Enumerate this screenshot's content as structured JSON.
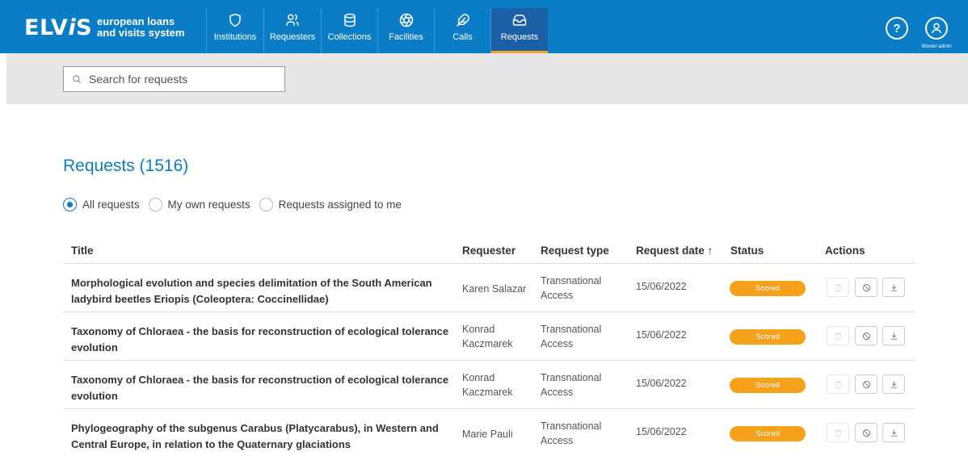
{
  "header": {
    "logo_main": "ELV",
    "logo_i": "i",
    "logo_s": "S",
    "logo_sub_line1": "european loans",
    "logo_sub_line2": "and visits system",
    "nav": [
      {
        "label": "Institutions",
        "icon": "shield-icon"
      },
      {
        "label": "Requesters",
        "icon": "users-icon"
      },
      {
        "label": "Collections",
        "icon": "database-icon"
      },
      {
        "label": "Facilities",
        "icon": "aperture-icon"
      },
      {
        "label": "Calls",
        "icon": "feather-icon"
      },
      {
        "label": "Requests",
        "icon": "inbox-icon",
        "active": true
      }
    ],
    "help_label": "?",
    "user_name": "Wouter admin",
    "brand_color": "#0b7dc7"
  },
  "search": {
    "placeholder": "Search for requests",
    "value": ""
  },
  "page": {
    "title": "Requests (1516)"
  },
  "filters": [
    {
      "label": "All requests",
      "checked": true
    },
    {
      "label": "My own requests",
      "checked": false
    },
    {
      "label": "Requests assigned to me",
      "checked": false
    }
  ],
  "table": {
    "columns": [
      "Title",
      "Requester",
      "Request type",
      "Request date ↑",
      "Status",
      "Actions"
    ],
    "rows": [
      {
        "title": "Morphological evolution and species delimitation of the South American ladybird beetles Eriopis (Coleoptera: Coccinellidae)",
        "requester": "Karen Salazar",
        "type": "Transnational Access",
        "date": "15/06/2022",
        "status": "Scored"
      },
      {
        "title": "Taxonomy of Chloraea - the basis for reconstruction of ecological tolerance evolution",
        "requester": "Konrad Kaczmarek",
        "type": "Transnational Access",
        "date": "15/06/2022",
        "status": "Scored"
      },
      {
        "title": "Taxonomy of Chloraea - the basis for reconstruction of ecological tolerance evolution",
        "requester": "Konrad Kaczmarek",
        "type": "Transnational Access",
        "date": "15/06/2022",
        "status": "Scored"
      },
      {
        "title": "Phylogeography of the subgenus Carabus (Platycarabus), in Western and Central Europe, in relation to the Quaternary glaciations",
        "requester": "Marie Pauli",
        "type": "Transnational Access",
        "date": "15/06/2022",
        "status": "Scored"
      }
    ],
    "status_color": "#f5a11c"
  }
}
